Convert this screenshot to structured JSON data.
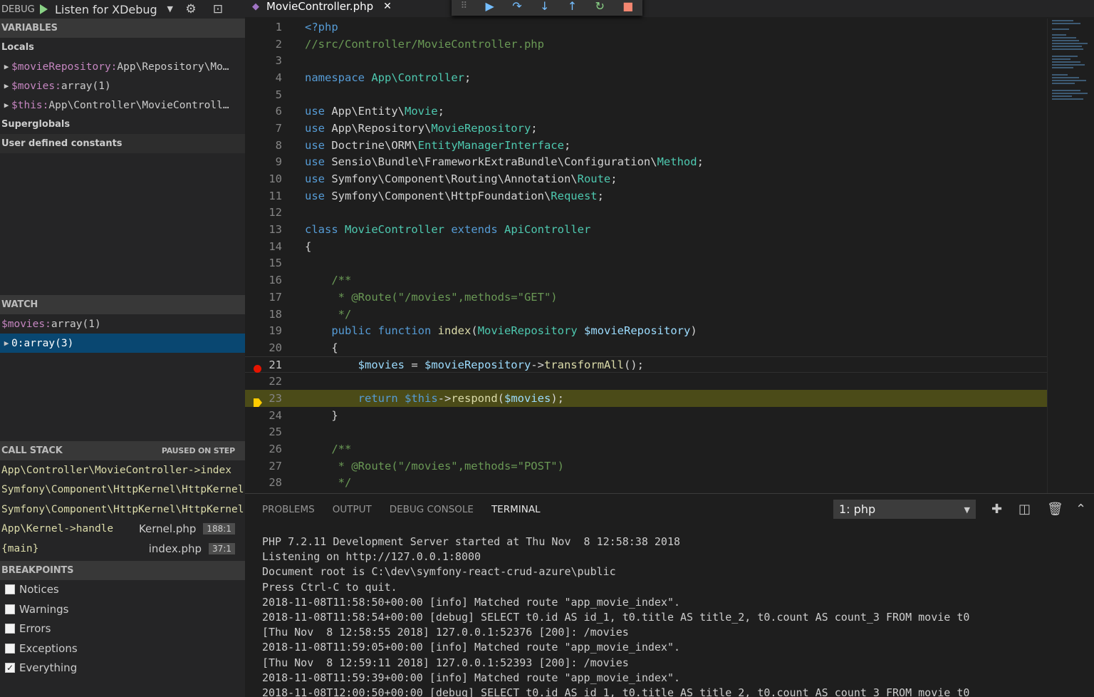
{
  "debug_toolbar": {
    "title": "DEBUG",
    "config": "Listen for XDebug"
  },
  "variables": {
    "header": "VARIABLES",
    "locals_label": "Locals",
    "items": [
      {
        "name": "$movieRepository:",
        "value": " App\\Repository\\Mo…"
      },
      {
        "name": "$movies:",
        "value": " array(1)"
      },
      {
        "name": "$this:",
        "value": " App\\Controller\\MovieControll…"
      }
    ],
    "superglobals_label": "Superglobals",
    "constants_label": "User defined constants"
  },
  "watch": {
    "header": "WATCH",
    "items": [
      {
        "name": "$movies:",
        "value": " array(1)"
      },
      {
        "name": "0:",
        "value": " array(3)"
      }
    ]
  },
  "call_stack": {
    "header": "CALL STACK",
    "status": "PAUSED ON STEP",
    "frames": [
      {
        "fn": "App\\Controller\\MovieController->index",
        "file": "",
        "pos": ""
      },
      {
        "fn": "Symfony\\Component\\HttpKernel\\HttpKernel",
        "file": "",
        "pos": ""
      },
      {
        "fn": "Symfony\\Component\\HttpKernel\\HttpKernel",
        "file": "",
        "pos": ""
      },
      {
        "fn": "App\\Kernel->handle",
        "file": "Kernel.php",
        "pos": "188:1"
      },
      {
        "fn": "{main}",
        "file": "index.php",
        "pos": "37:1"
      }
    ]
  },
  "breakpoints": {
    "header": "BREAKPOINTS",
    "items": [
      {
        "label": "Notices",
        "checked": false
      },
      {
        "label": "Warnings",
        "checked": false
      },
      {
        "label": "Errors",
        "checked": false
      },
      {
        "label": "Exceptions",
        "checked": false
      },
      {
        "label": "Everything",
        "checked": true
      }
    ]
  },
  "editor": {
    "tab_label": "MovieController.php",
    "lines": [
      {
        "n": "1",
        "parts": [
          [
            "kw",
            "<?php"
          ]
        ]
      },
      {
        "n": "2",
        "parts": [
          [
            "cm",
            "//src/Controller/MovieController.php"
          ]
        ]
      },
      {
        "n": "3",
        "parts": []
      },
      {
        "n": "4",
        "parts": [
          [
            "kw",
            "namespace"
          ],
          [
            "pl",
            " "
          ],
          [
            "ty",
            "App\\Controller"
          ],
          [
            "pl",
            ";"
          ]
        ]
      },
      {
        "n": "5",
        "parts": []
      },
      {
        "n": "6",
        "parts": [
          [
            "kw",
            "use"
          ],
          [
            "pl",
            " App\\Entity\\"
          ],
          [
            "ty",
            "Movie"
          ],
          [
            "pl",
            ";"
          ]
        ]
      },
      {
        "n": "7",
        "parts": [
          [
            "kw",
            "use"
          ],
          [
            "pl",
            " App\\Repository\\"
          ],
          [
            "ty",
            "MovieRepository"
          ],
          [
            "pl",
            ";"
          ]
        ]
      },
      {
        "n": "8",
        "parts": [
          [
            "kw",
            "use"
          ],
          [
            "pl",
            " Doctrine\\ORM\\"
          ],
          [
            "ty",
            "EntityManagerInterface"
          ],
          [
            "pl",
            ";"
          ]
        ]
      },
      {
        "n": "9",
        "parts": [
          [
            "kw",
            "use"
          ],
          [
            "pl",
            " Sensio\\Bundle\\FrameworkExtraBundle\\Configuration\\"
          ],
          [
            "ty",
            "Method"
          ],
          [
            "pl",
            ";"
          ]
        ]
      },
      {
        "n": "10",
        "parts": [
          [
            "kw",
            "use"
          ],
          [
            "pl",
            " Symfony\\Component\\Routing\\Annotation\\"
          ],
          [
            "ty",
            "Route"
          ],
          [
            "pl",
            ";"
          ]
        ]
      },
      {
        "n": "11",
        "parts": [
          [
            "kw",
            "use"
          ],
          [
            "pl",
            " Symfony\\Component\\HttpFoundation\\"
          ],
          [
            "ty",
            "Request"
          ],
          [
            "pl",
            ";"
          ]
        ]
      },
      {
        "n": "12",
        "parts": []
      },
      {
        "n": "13",
        "parts": [
          [
            "kw",
            "class"
          ],
          [
            "pl",
            " "
          ],
          [
            "ty",
            "MovieController"
          ],
          [
            "pl",
            " "
          ],
          [
            "kw",
            "extends"
          ],
          [
            "pl",
            " "
          ],
          [
            "ty",
            "ApiController"
          ]
        ]
      },
      {
        "n": "14",
        "parts": [
          [
            "pl",
            "{"
          ]
        ]
      },
      {
        "n": "15",
        "parts": []
      },
      {
        "n": "16",
        "parts": [
          [
            "pl",
            "    "
          ],
          [
            "cm",
            "/**"
          ]
        ]
      },
      {
        "n": "17",
        "parts": [
          [
            "pl",
            "     "
          ],
          [
            "cm",
            "* @Route(\"/movies\",methods=\"GET\")"
          ]
        ]
      },
      {
        "n": "18",
        "parts": [
          [
            "pl",
            "     "
          ],
          [
            "cm",
            "*/"
          ]
        ]
      },
      {
        "n": "19",
        "parts": [
          [
            "pl",
            "    "
          ],
          [
            "kw",
            "public"
          ],
          [
            "pl",
            " "
          ],
          [
            "kw",
            "function"
          ],
          [
            "pl",
            " "
          ],
          [
            "fn",
            "index"
          ],
          [
            "pl",
            "("
          ],
          [
            "ty",
            "MovieRepository"
          ],
          [
            "pl",
            " "
          ],
          [
            "vr",
            "$movieRepository"
          ],
          [
            "pl",
            ")"
          ]
        ]
      },
      {
        "n": "20",
        "parts": [
          [
            "pl",
            "    {"
          ]
        ]
      },
      {
        "n": "21",
        "parts": [
          [
            "pl",
            "        "
          ],
          [
            "vr",
            "$movies"
          ],
          [
            "pl",
            " = "
          ],
          [
            "vr",
            "$movieRepository"
          ],
          [
            "pl",
            "->"
          ],
          [
            "fn",
            "transformAll"
          ],
          [
            "pl",
            "();"
          ]
        ]
      },
      {
        "n": "22",
        "parts": []
      },
      {
        "n": "23",
        "parts": [
          [
            "pl",
            "        "
          ],
          [
            "kw",
            "return"
          ],
          [
            "pl",
            " "
          ],
          [
            "kw",
            "$this"
          ],
          [
            "pl",
            "->"
          ],
          [
            "fn",
            "respond"
          ],
          [
            "pl",
            "("
          ],
          [
            "vr",
            "$movies"
          ],
          [
            "pl",
            ");"
          ]
        ]
      },
      {
        "n": "24",
        "parts": [
          [
            "pl",
            "    }"
          ]
        ]
      },
      {
        "n": "25",
        "parts": []
      },
      {
        "n": "26",
        "parts": [
          [
            "pl",
            "    "
          ],
          [
            "cm",
            "/**"
          ]
        ]
      },
      {
        "n": "27",
        "parts": [
          [
            "pl",
            "     "
          ],
          [
            "cm",
            "* @Route(\"/movies\",methods=\"POST\")"
          ]
        ]
      },
      {
        "n": "28",
        "parts": [
          [
            "pl",
            "     "
          ],
          [
            "cm",
            "*/"
          ]
        ]
      }
    ]
  },
  "panel": {
    "tabs": [
      "PROBLEMS",
      "OUTPUT",
      "DEBUG CONSOLE",
      "TERMINAL"
    ],
    "active_tab": "TERMINAL",
    "terminal_select": "1: php",
    "terminal_lines": [
      "PHP 7.2.11 Development Server started at Thu Nov  8 12:58:38 2018",
      "Listening on http://127.0.0.1:8000",
      "Document root is C:\\dev\\symfony-react-crud-azure\\public",
      "Press Ctrl-C to quit.",
      "2018-11-08T11:58:50+00:00 [info] Matched route \"app_movie_index\".",
      "2018-11-08T11:58:54+00:00 [debug] SELECT t0.id AS id_1, t0.title AS title_2, t0.count AS count_3 FROM movie t0",
      "[Thu Nov  8 12:58:55 2018] 127.0.0.1:52376 [200]: /movies",
      "2018-11-08T11:59:05+00:00 [info] Matched route \"app_movie_index\".",
      "[Thu Nov  8 12:59:11 2018] 127.0.0.1:52393 [200]: /movies",
      "2018-11-08T11:59:39+00:00 [info] Matched route \"app_movie_index\".",
      "2018-11-08T12:00:50+00:00 [debug] SELECT t0.id AS id_1, t0.title AS title_2, t0.count AS count_3 FROM movie t0"
    ]
  },
  "colors": {
    "selection": "#094771",
    "current_line": "#4b4b18",
    "breakpoint": "#e51400",
    "stop_arrow": "#ffcc00"
  }
}
